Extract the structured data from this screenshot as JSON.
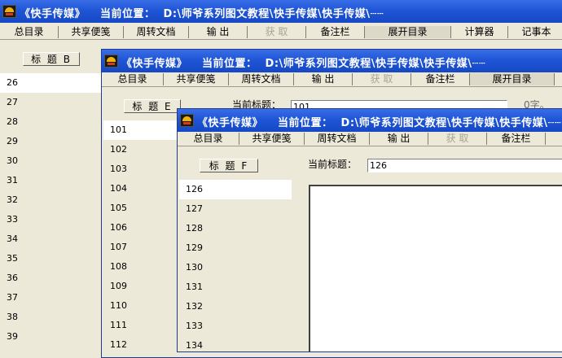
{
  "title": {
    "app": "《快手传媒》",
    "location": "当前位置：",
    "path": "D:\\师爷系列图文教程\\快手传媒\\快手传媒\\┄┄"
  },
  "menu": [
    {
      "label": "总目录",
      "enabled": true
    },
    {
      "label": "共享便笺",
      "enabled": true
    },
    {
      "label": "周转文档",
      "enabled": true
    },
    {
      "label": "输 出",
      "enabled": true
    },
    {
      "label": "获 取",
      "enabled": false
    },
    {
      "label": "备注栏",
      "enabled": true
    },
    {
      "label": "展开目录",
      "enabled": true
    },
    {
      "label": "计算器",
      "enabled": true
    },
    {
      "label": "记事本",
      "enabled": true
    }
  ],
  "windows": {
    "back": {
      "title_button": "标 题 B",
      "items": [
        "26",
        "27",
        "28",
        "29",
        "30",
        "31",
        "32",
        "33",
        "34",
        "35",
        "36",
        "37",
        "38",
        "39"
      ]
    },
    "middle": {
      "title_button": "标 题 E",
      "current_title_label": "当前标题：",
      "current_title_value": "101",
      "char_count": "0字。",
      "items": [
        "101",
        "102",
        "103",
        "104",
        "105",
        "106",
        "107",
        "108",
        "109",
        "110",
        "111",
        "112"
      ]
    },
    "front": {
      "title_button": "标 题 F",
      "current_title_label": "当前标题：",
      "current_title_value": "126",
      "items": [
        "126",
        "127",
        "128",
        "129",
        "130",
        "131",
        "132",
        "133",
        "134"
      ]
    }
  }
}
